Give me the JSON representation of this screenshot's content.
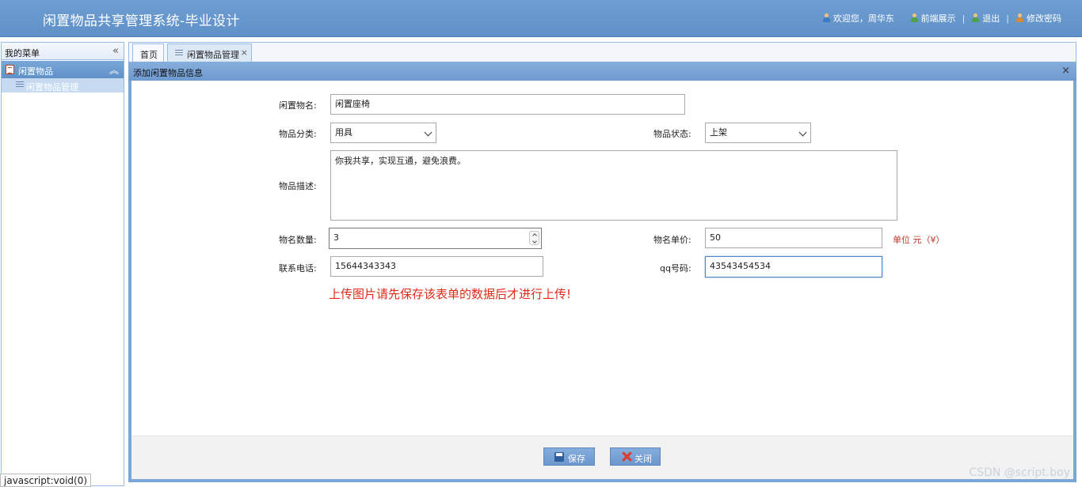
{
  "header": {
    "title": "闲置物品共享管理系统-毕业设计",
    "links": {
      "welcome": "欢迎您，周华东",
      "frontend": "前端展示",
      "logout": "退出",
      "change_password": "修改密码",
      "separator": "|"
    }
  },
  "sidebar": {
    "title": "我的菜单",
    "collapse_icon": "«",
    "group": {
      "label": "闲置物品",
      "toggle_icon": "︽"
    },
    "items": [
      {
        "label": "闲置物品管理"
      }
    ]
  },
  "tabs": [
    {
      "label": "首页"
    },
    {
      "label": "闲置物品管理",
      "close": "×"
    }
  ],
  "panel": {
    "title": "添加闲置物品信息",
    "close": "×"
  },
  "form": {
    "name": {
      "label": "闲置物名:",
      "value": "闲置座椅"
    },
    "category": {
      "label": "物品分类:",
      "value": "用具"
    },
    "status": {
      "label": "物品状态:",
      "value": "上架"
    },
    "description": {
      "label": "物品描述:",
      "value": "你我共享，实现互通，避免浪费。"
    },
    "quantity": {
      "label": "物名数量:",
      "value": "3"
    },
    "price": {
      "label": "物名单价:",
      "value": "50",
      "unit": "单位 元（¥）"
    },
    "phone": {
      "label": "联系电话:",
      "value": "15644343343"
    },
    "qq": {
      "label": "qq号码:",
      "value": "43543454534"
    },
    "upload_notice": "上传图片请先保存该表单的数据后才进行上传!"
  },
  "buttons": {
    "save": "保存",
    "close": "关闭"
  },
  "statusbar": "javascript:void(0)",
  "watermark": "CSDN @script.boy",
  "colors": {
    "header": "#6e9fd3",
    "accent": "#7ba7d6",
    "warning": "#e02a1a"
  }
}
